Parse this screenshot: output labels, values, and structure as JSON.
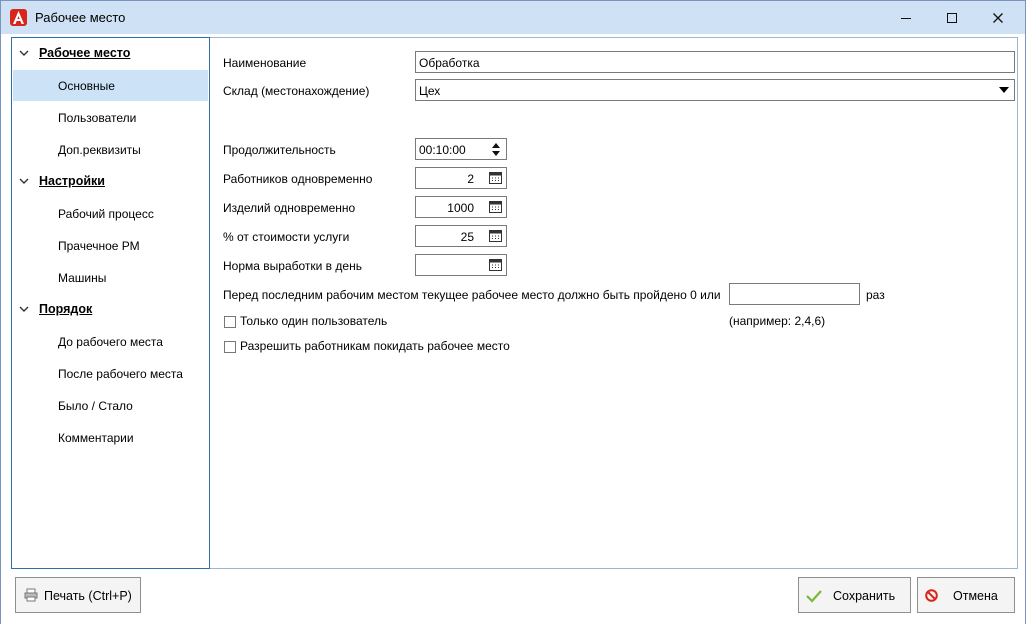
{
  "window": {
    "title": "Рабочее место"
  },
  "sidebar": {
    "groups": [
      {
        "label": "Рабочее место",
        "items": [
          "Основные",
          "Пользователи",
          "Доп.реквизиты"
        ]
      },
      {
        "label": "Настройки",
        "items": [
          "Рабочий процесс",
          "Прачечное РМ",
          "Машины"
        ]
      },
      {
        "label": "Порядок",
        "items": [
          "До рабочего места",
          "После рабочего места",
          "Было / Стало",
          "Комментарии"
        ]
      }
    ],
    "selected": "Основные"
  },
  "form": {
    "name_label": "Наименование",
    "name_value": "Обработка",
    "warehouse_label": "Склад (местонахождение)",
    "warehouse_value": "Цех",
    "duration_label": "Продолжительность",
    "duration_value": "00:10:00",
    "workers_label": "Работников одновременно",
    "workers_value": "2",
    "items_label": "Изделий одновременно",
    "items_value": "1000",
    "percent_label": "% от стоимости услуги",
    "percent_value": "25",
    "norm_label": "Норма выработки в день",
    "norm_value": "",
    "before_last_label": "Перед последним рабочим местом текущее рабочее место должно быть пройдено 0 или",
    "before_last_value": "",
    "times_label": "раз",
    "example_label": "(например: 2,4,6)",
    "only_one_user_label": "Только один пользователь",
    "only_one_user_checked": false,
    "allow_leave_label": "Разрешить работникам покидать рабочее место",
    "allow_leave_checked": false
  },
  "footer": {
    "print_label": "Печать (Ctrl+P)",
    "save_label": "Сохранить",
    "cancel_label": "Отмена"
  }
}
